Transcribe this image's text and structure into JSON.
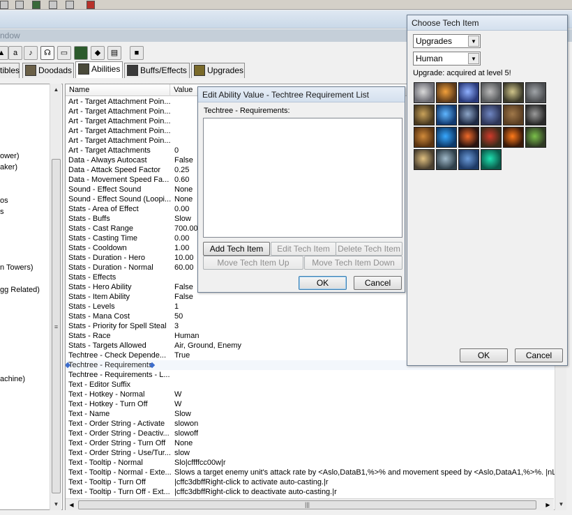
{
  "window": {
    "title_fragment": "ndow"
  },
  "tabs": [
    {
      "label": "tibles"
    },
    {
      "label": "Doodads"
    },
    {
      "label": "Abilities"
    },
    {
      "label": "Buffs/Effects"
    },
    {
      "label": "Upgrades"
    }
  ],
  "left_tree": [
    {
      "label": "ower)"
    },
    {
      "label": "aker)"
    },
    {
      "label": "os"
    },
    {
      "label": "s"
    },
    {
      "label": "n Towers)"
    },
    {
      "label": "gg Related)"
    },
    {
      "label": "achine)"
    }
  ],
  "grid": {
    "col_name": "Name",
    "col_value": "Value",
    "rows": [
      {
        "name": "Art - Target Attachment Poin...",
        "value": ""
      },
      {
        "name": "Art - Target Attachment Poin...",
        "value": ""
      },
      {
        "name": "Art - Target Attachment Poin...",
        "value": ""
      },
      {
        "name": "Art - Target Attachment Poin...",
        "value": ""
      },
      {
        "name": "Art - Target Attachment Poin...",
        "value": ""
      },
      {
        "name": "Art - Target Attachments",
        "value": "0"
      },
      {
        "name": "Data - Always Autocast",
        "value": "False"
      },
      {
        "name": "Data - Attack Speed Factor",
        "value": "0.25"
      },
      {
        "name": "Data - Movement Speed Fa...",
        "value": "0.60"
      },
      {
        "name": "Sound - Effect Sound",
        "value": "None"
      },
      {
        "name": "Sound - Effect Sound (Loopi...",
        "value": "None"
      },
      {
        "name": "Stats - Area of Effect",
        "value": "0.00"
      },
      {
        "name": "Stats - Buffs",
        "value": "Slow"
      },
      {
        "name": "Stats - Cast Range",
        "value": "700.00"
      },
      {
        "name": "Stats - Casting Time",
        "value": "0.00"
      },
      {
        "name": "Stats - Cooldown",
        "value": "1.00"
      },
      {
        "name": "Stats - Duration - Hero",
        "value": "10.00"
      },
      {
        "name": "Stats - Duration - Normal",
        "value": "60.00"
      },
      {
        "name": "Stats - Effects",
        "value": ""
      },
      {
        "name": "Stats - Hero Ability",
        "value": "False"
      },
      {
        "name": "Stats - Item Ability",
        "value": "False"
      },
      {
        "name": "Stats - Levels",
        "value": "1"
      },
      {
        "name": "Stats - Mana Cost",
        "value": "50"
      },
      {
        "name": "Stats - Priority for Spell Steal",
        "value": "3"
      },
      {
        "name": "Stats - Race",
        "value": "Human"
      },
      {
        "name": "Stats - Targets Allowed",
        "value": "Air, Ground, Enemy"
      },
      {
        "name": "Techtree - Check Depende...",
        "value": "True"
      },
      {
        "name": "Techtree - Requirements",
        "value": "",
        "selected": true
      },
      {
        "name": "Techtree - Requirements - L...",
        "value": ""
      },
      {
        "name": "Text - Editor Suffix",
        "value": ""
      },
      {
        "name": "Text - Hotkey - Normal",
        "value": "W"
      },
      {
        "name": "Text - Hotkey - Turn Off",
        "value": "W"
      },
      {
        "name": "Text - Name",
        "value": "Slow"
      },
      {
        "name": "Text - Order String - Activate",
        "value": "slowon"
      },
      {
        "name": "Text - Order String - Deactiv...",
        "value": "slowoff"
      },
      {
        "name": "Text - Order String - Turn Off",
        "value": "None"
      },
      {
        "name": "Text - Order String - Use/Tur...",
        "value": "slow"
      },
      {
        "name": "Text - Tooltip - Normal",
        "value": "Slo|cffffcc00w|r"
      },
      {
        "name": "Text - Tooltip - Normal - Exte...",
        "value": "Slows a target enemy unit's attack rate by <Aslo,DataB1,%>% and movement speed by <Aslo,DataA1,%>%. |nLast..."
      },
      {
        "name": "Text - Tooltip - Turn Off",
        "value": "|cffc3dbffRight-click to activate auto-casting.|r"
      },
      {
        "name": "Text - Tooltip - Turn Off - Ext...",
        "value": "|cffc3dbffRight-click to deactivate auto-casting.|r"
      }
    ]
  },
  "edit_dialog": {
    "title": "Edit Ability Value - Techtree Requirement List",
    "label": "Techtree - Requirements:",
    "add": "Add Tech Item",
    "edit": "Edit Tech Item",
    "delete": "Delete Tech Item",
    "move_up": "Move Tech Item Up",
    "move_down": "Move Tech Item Down",
    "ok": "OK",
    "cancel": "Cancel"
  },
  "choose_dialog": {
    "title": "Choose Tech Item",
    "type_value": "Upgrades",
    "race_value": "Human",
    "status": "Upgrade: acquired at level 5!",
    "ok": "OK",
    "cancel": "Cancel",
    "icons": [
      {
        "name": "sword-icon",
        "color": "#6a6a72",
        "accent": "#d9d9d9"
      },
      {
        "name": "flame-sword-icon",
        "color": "#5c3a1a",
        "accent": "#f2a03a"
      },
      {
        "name": "mage-icon",
        "color": "#2a3a7a",
        "accent": "#8fb0ff"
      },
      {
        "name": "shield-icon",
        "color": "#585a5c",
        "accent": "#b9b9b9"
      },
      {
        "name": "spear-icon",
        "color": "#3c3a2a",
        "accent": "#cfc48a"
      },
      {
        "name": "chain-icon",
        "color": "#4b4d50",
        "accent": "#a0a4a8"
      },
      {
        "name": "hammer-icon",
        "color": "#4a3a20",
        "accent": "#c9a25a"
      },
      {
        "name": "orb-icon",
        "color": "#123a70",
        "accent": "#5fb6ff"
      },
      {
        "name": "claw-icon",
        "color": "#1f2a44",
        "accent": "#8da6c8"
      },
      {
        "name": "book-icon",
        "color": "#2e3658",
        "accent": "#6f86c2"
      },
      {
        "name": "armor-icon",
        "color": "#5a3e22",
        "accent": "#a0784a"
      },
      {
        "name": "ring-icon",
        "color": "#2a2a2a",
        "accent": "#9a9a9a"
      },
      {
        "name": "tower-icon",
        "color": "#5a3412",
        "accent": "#d08a3a"
      },
      {
        "name": "water-icon",
        "color": "#0e3a6a",
        "accent": "#37a8ff"
      },
      {
        "name": "fire-arrow-icon",
        "color": "#2a1410",
        "accent": "#f06a2a"
      },
      {
        "name": "banner-icon",
        "color": "#3a2a1a",
        "accent": "#d03a2a"
      },
      {
        "name": "fire-icon",
        "color": "#3a1a0a",
        "accent": "#ff7a1a"
      },
      {
        "name": "potion-icon",
        "color": "#2f3a24",
        "accent": "#7ac04a"
      },
      {
        "name": "bolt-icon",
        "color": "#4a4030",
        "accent": "#e0c080"
      },
      {
        "name": "knight-icon",
        "color": "#30404a",
        "accent": "#9fb8c8"
      },
      {
        "name": "wave-icon",
        "color": "#1e3a66",
        "accent": "#6a9ad8"
      },
      {
        "name": "rune-icon",
        "color": "#0b5a4a",
        "accent": "#1ee0b0"
      }
    ]
  }
}
